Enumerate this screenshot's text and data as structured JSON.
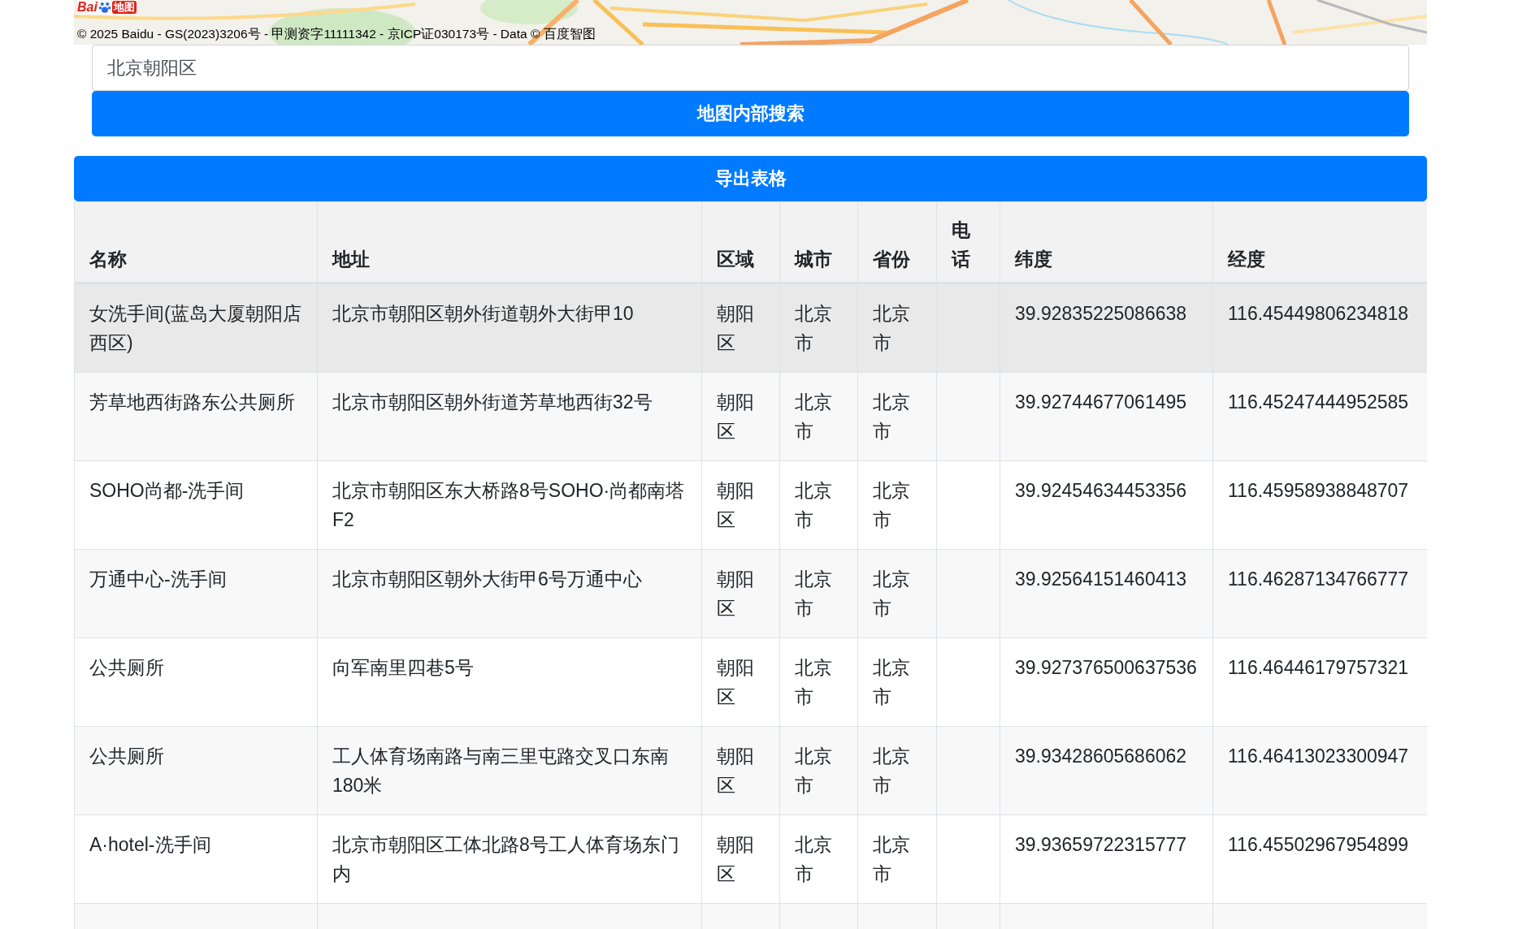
{
  "map": {
    "logo": {
      "left": "Bai",
      "right": "地图"
    },
    "copyright": "© 2025 Baidu - GS(2023)3206号 - 甲测资字11111342 - 京ICP证030173号 - Data © 百度智图"
  },
  "search": {
    "value": "北京朝阳区",
    "button": "地图内部搜索"
  },
  "export_button": "导出表格",
  "table": {
    "columns": [
      "名称",
      "地址",
      "区域",
      "城市",
      "省份",
      "电话",
      "纬度",
      "经度"
    ],
    "rows": [
      {
        "highlighted": true,
        "cells": [
          "女洗手间(蓝岛大厦朝阳店西区)",
          "北京市朝阳区朝外街道朝外大街甲10",
          "朝阳区",
          "北京市",
          "北京市",
          "",
          "39.92835225086638",
          "116.45449806234818"
        ]
      },
      {
        "highlighted": false,
        "cells": [
          "芳草地西街路东公共厕所",
          "北京市朝阳区朝外街道芳草地西街32号",
          "朝阳区",
          "北京市",
          "北京市",
          "",
          "39.92744677061495",
          "116.45247444952585"
        ]
      },
      {
        "highlighted": false,
        "cells": [
          "SOHO尚都-洗手间",
          "北京市朝阳区东大桥路8号SOHO·尚都南塔F2",
          "朝阳区",
          "北京市",
          "北京市",
          "",
          "39.92454634453356",
          "116.45958938848707"
        ]
      },
      {
        "highlighted": false,
        "cells": [
          "万通中心-洗手间",
          "北京市朝阳区朝外大街甲6号万通中心",
          "朝阳区",
          "北京市",
          "北京市",
          "",
          "39.92564151460413",
          "116.46287134766777"
        ]
      },
      {
        "highlighted": false,
        "cells": [
          "公共厕所",
          "向军南里四巷5号",
          "朝阳区",
          "北京市",
          "北京市",
          "",
          "39.927376500637536",
          "116.46446179757321"
        ]
      },
      {
        "highlighted": false,
        "cells": [
          "公共厕所",
          "工人体育场南路与南三里屯路交叉口东南180米",
          "朝阳区",
          "北京市",
          "北京市",
          "",
          "39.93428605686062",
          "116.46413023300947"
        ]
      },
      {
        "highlighted": false,
        "cells": [
          "A·hotel-洗手间",
          "北京市朝阳区工体北路8号工人体育场东门内",
          "朝阳区",
          "北京市",
          "北京市",
          "",
          "39.93659722315777",
          "116.45502967954899"
        ]
      }
    ]
  }
}
